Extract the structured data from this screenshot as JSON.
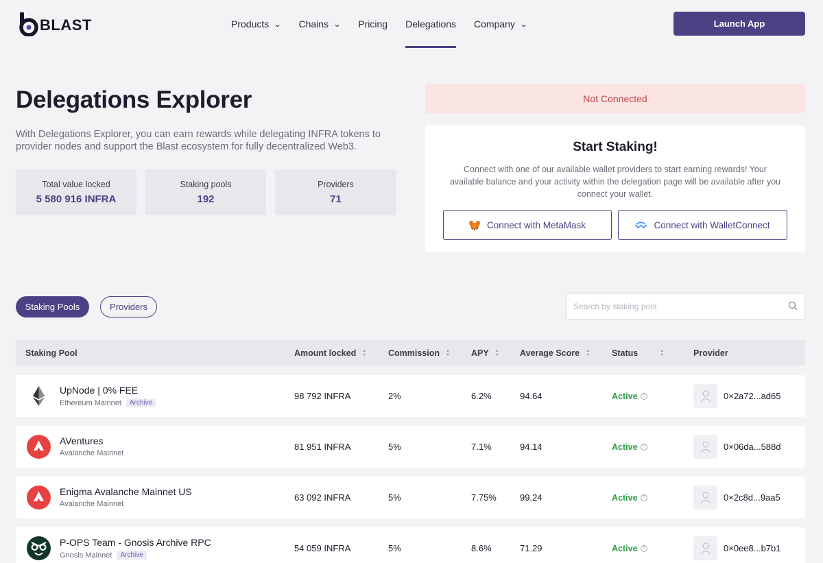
{
  "nav": {
    "logo_text": "BLAST",
    "menu": [
      {
        "label": "Products",
        "has_dropdown": true,
        "active": false
      },
      {
        "label": "Chains",
        "has_dropdown": true,
        "active": false
      },
      {
        "label": "Pricing",
        "has_dropdown": false,
        "active": false
      },
      {
        "label": "Delegations",
        "has_dropdown": false,
        "active": true
      },
      {
        "label": "Company",
        "has_dropdown": true,
        "active": false
      }
    ],
    "cta_label": "Launch App"
  },
  "hero": {
    "title": "Delegations Explorer",
    "description": "With Delegations Explorer, you can earn rewards while delegating INFRA tokens to provider nodes and support the Blast ecosystem for fully decentralized Web3.",
    "stats": [
      {
        "label": "Total value locked",
        "value": "5 580 916 INFRA"
      },
      {
        "label": "Staking pools",
        "value": "192"
      },
      {
        "label": "Providers",
        "value": "71"
      }
    ]
  },
  "connection": {
    "status": "Not Connected",
    "title": "Start Staking!",
    "description": "Connect with one of our available wallet providers to start earning rewards! Your available balance and your activity within the delegation page will be available after you connect your wallet.",
    "metamask_label": "Connect with MetaMask",
    "walletconnect_label": "Connect with WalletConnect"
  },
  "tabs": {
    "active": "Staking Pools",
    "inactive": "Providers"
  },
  "search": {
    "placeholder": "Search by staking pool",
    "value": ""
  },
  "table": {
    "columns": [
      "Staking Pool",
      "Amount locked",
      "Commission",
      "APY",
      "Average Score",
      "Status",
      "Provider"
    ],
    "rows": [
      {
        "chain": "ethereum",
        "name": "UpNode | 0% FEE",
        "network": "Ethereum Mainnet",
        "badge": "Archive",
        "amount": "98 792 INFRA",
        "commission": "2%",
        "apy": "6.2%",
        "score": "94.64",
        "status": "Active",
        "provider": "0×2a72...ad65"
      },
      {
        "chain": "avalanche",
        "name": "AVentures",
        "network": "Avalanche Mainnet",
        "badge": "",
        "amount": "81 951 INFRA",
        "commission": "5%",
        "apy": "7.1%",
        "score": "94.14",
        "status": "Active",
        "provider": "0×06da...588d"
      },
      {
        "chain": "avalanche",
        "name": "Enigma Avalanche Mainnet US",
        "network": "Avalanche Mainnet",
        "badge": "",
        "amount": "63 092 INFRA",
        "commission": "5%",
        "apy": "7.75%",
        "score": "99.24",
        "status": "Active",
        "provider": "0×2c8d...9aa5"
      },
      {
        "chain": "gnosis",
        "name": "P-OPS Team - Gnosis Archive RPC",
        "network": "Gnosis Mainnet",
        "badge": "Archive",
        "amount": "54 059 INFRA",
        "commission": "5%",
        "apy": "8.6%",
        "score": "71.29",
        "status": "Active",
        "provider": "0×0ee8...b7b1"
      }
    ]
  },
  "colors": {
    "accent": "#4d4185",
    "page_bg": "#f3f3f5",
    "status_active": "#2f9e44",
    "alert_bg": "#fbe4e4",
    "alert_text": "#c24444",
    "avalanche_red": "#e84142",
    "gnosis_green": "#133629"
  }
}
